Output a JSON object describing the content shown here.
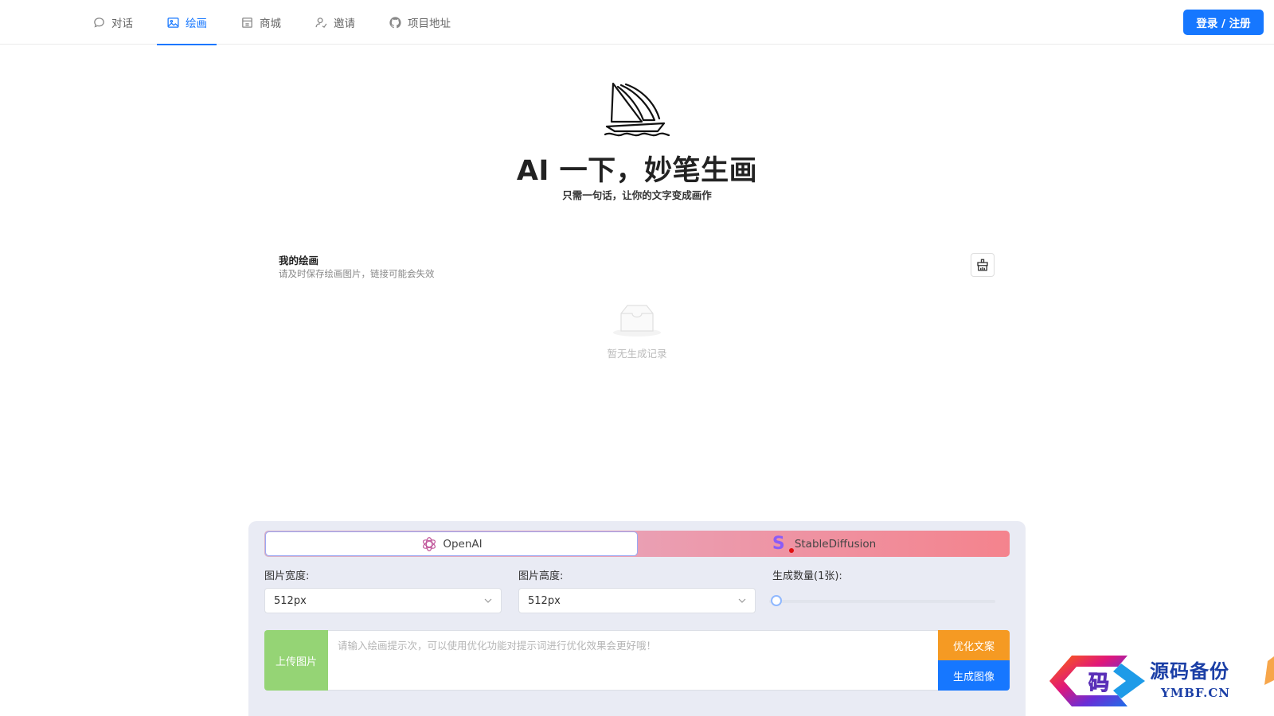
{
  "nav": {
    "items": [
      {
        "label": "对话",
        "icon": "chat-icon"
      },
      {
        "label": "绘画",
        "icon": "image-icon"
      },
      {
        "label": "商城",
        "icon": "shop-icon"
      },
      {
        "label": "邀请",
        "icon": "invite-icon"
      },
      {
        "label": "项目地址",
        "icon": "github-icon"
      }
    ],
    "active_index": 1,
    "login_label": "登录 / 注册"
  },
  "hero": {
    "logo": "sailboat-logo",
    "title": "AI 一下，妙笔生画",
    "subtitle": "只需一句话，让你的文字变成画作"
  },
  "gallery": {
    "title": "我的绘画",
    "description": "请及时保存绘画图片，链接可能会失效",
    "clean_icon": "broom-icon",
    "empty_icon": "inbox-icon",
    "empty_text": "暂无生成记录"
  },
  "panel": {
    "models": [
      {
        "label": "OpenAI",
        "icon": "openai-icon",
        "selected": true
      },
      {
        "label": "StableDiffusion",
        "icon": "stablediffusion-icon",
        "selected": false
      }
    ],
    "width_label": "图片宽度:",
    "width_value": "512px",
    "height_label": "图片高度:",
    "height_value": "512px",
    "count_label": "生成数量(1张):",
    "count_value": 1,
    "upload_label": "上传图片",
    "prompt_placeholder": "请输入绘画提示次，可以使用优化功能对提示词进行优化效果会更好哦！",
    "prompt_value": "",
    "optimize_label": "优化文案",
    "generate_label": "生成图像"
  },
  "watermark": {
    "logo_char": "码",
    "cn_text": "源码备份",
    "en_text": "YMBF.CN"
  },
  "colors": {
    "primary": "#1677ff",
    "upload": "#95d475",
    "optimize": "#f59a23",
    "panel_bg": "#e9ebf4"
  }
}
